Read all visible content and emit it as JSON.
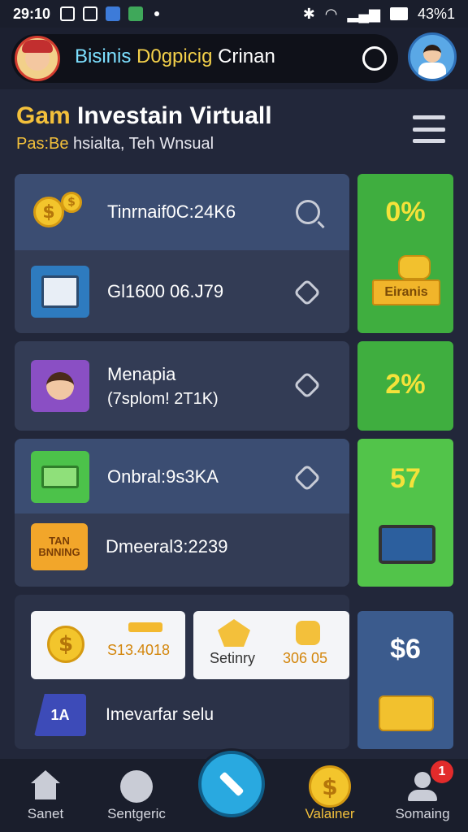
{
  "status_bar": {
    "time": "29:10",
    "battery": "43%1"
  },
  "search": {
    "text_part1": "Bisinis ",
    "text_part2": "D0gpicig ",
    "text_part3": "Crinan"
  },
  "header": {
    "title_part1": "Gam ",
    "title_part2": "Investain Virtuall",
    "subtitle_part1": "Pas:Be ",
    "subtitle_part2": "hsialta, Teh Wnsual"
  },
  "cards": {
    "card1": {
      "row1_label": "Tinrnaif0C:24K6",
      "row2_label": "Gl1600 06.J79"
    },
    "tile1_value": "0%",
    "tile1_badge": "Eiranis",
    "card2": {
      "row1_label": "Menapia",
      "row1_sub": "(7splom! 2T1K)"
    },
    "tile2_value": "2%",
    "card3": {
      "row1_label": "Onbral:9s3KA",
      "row2_label": "Dmeeral3:2239",
      "row2_icon_text": "TAN\nBNNING"
    },
    "tile3_value": "57",
    "bottom_panel": {
      "wcard1_value": "S13.4018",
      "wcard2_label": "Setinry",
      "wcard2_value": "306 05",
      "row_label": "Imevarfar selu",
      "row_icon_text": "1A"
    },
    "tile4_value": "$6"
  },
  "nav": {
    "items": [
      {
        "label": "Sanet",
        "icon": "home-icon"
      },
      {
        "label": "Sentgeric",
        "icon": "shield-icon"
      },
      {
        "label": "Valainer",
        "icon": "coin-icon"
      },
      {
        "label": "Somaing",
        "icon": "user-icon"
      }
    ],
    "badge": "1"
  },
  "colors": {
    "accent": "#f3c03b",
    "green": "#3fae3f",
    "card": "#333c55",
    "background": "#22273a"
  }
}
